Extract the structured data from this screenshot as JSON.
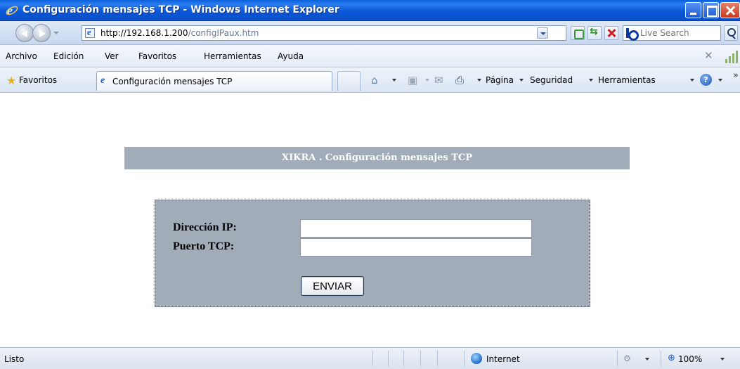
{
  "window": {
    "title": "Configuración mensajes TCP - Windows Internet Explorer"
  },
  "address_bar": {
    "url_host": "http://192.168.1.200",
    "url_path": "/configIPaux.htm",
    "search_placeholder": "Live Search"
  },
  "menu": {
    "items": [
      "Archivo",
      "Edición",
      "Ver",
      "Favoritos",
      "Herramientas",
      "Ayuda"
    ]
  },
  "favorites_bar": {
    "favorites_label": "Favoritos",
    "tab_label": "Configuración mensajes TCP",
    "commands": [
      "Página",
      "Seguridad",
      "Herramientas"
    ]
  },
  "page": {
    "banner_title": "XIKRA . Configuración mensajes TCP",
    "ip_label": "Dirección IP:",
    "ip_value": "",
    "port_label": "Puerto TCP:",
    "port_value": "",
    "submit_label": "ENVIAR"
  },
  "status_bar": {
    "status": "Listo",
    "zone": "Internet",
    "zoom": "100%"
  }
}
